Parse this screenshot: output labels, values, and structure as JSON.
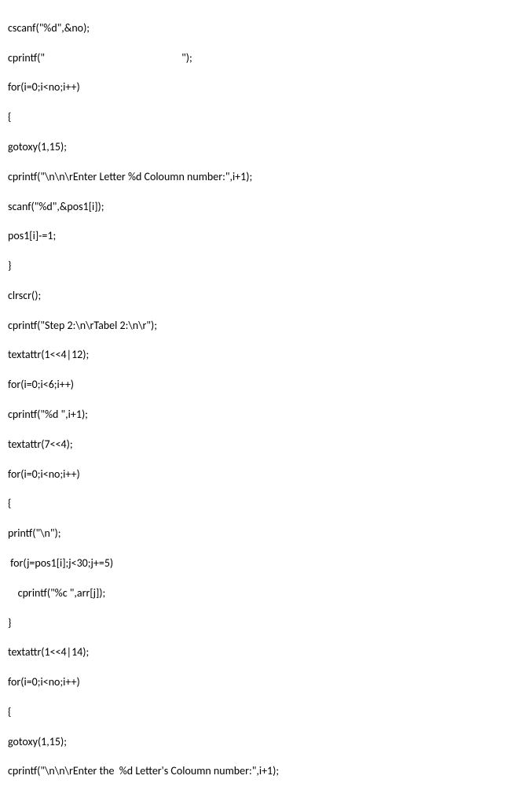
{
  "code": {
    "lines": [
      "cscanf(\"%d\",&no);",
      "cprintf(\"                                                       \");",
      "for(i=0;i<no;i++)",
      "{",
      "gotoxy(1,15);",
      "cprintf(\"\\n\\n\\rEnter Letter %d Coloumn number:\",i+1);",
      "scanf(\"%d\",&pos1[i]);",
      "pos1[i]-=1;",
      "}",
      "clrscr();",
      "cprintf(\"Step 2:\\n\\rTabel 2:\\n\\r\");",
      "textattr(1<<4|12);",
      "for(i=0;i<6;i++)",
      "cprintf(\"%d \",i+1);",
      "textattr(7<<4);",
      "for(i=0;i<no;i++)",
      "{",
      "printf(\"\\n\");",
      " for(j=pos1[i];j<30;j+=5)",
      "    cprintf(\"%c \",arr[j]);",
      "}",
      "textattr(1<<4|14);",
      "for(i=0;i<no;i++)",
      "{",
      "gotoxy(1,15);",
      "cprintf(\"\\n\\n\\rEnter the  %d Letter's Coloumn number:\",i+1);"
    ]
  }
}
